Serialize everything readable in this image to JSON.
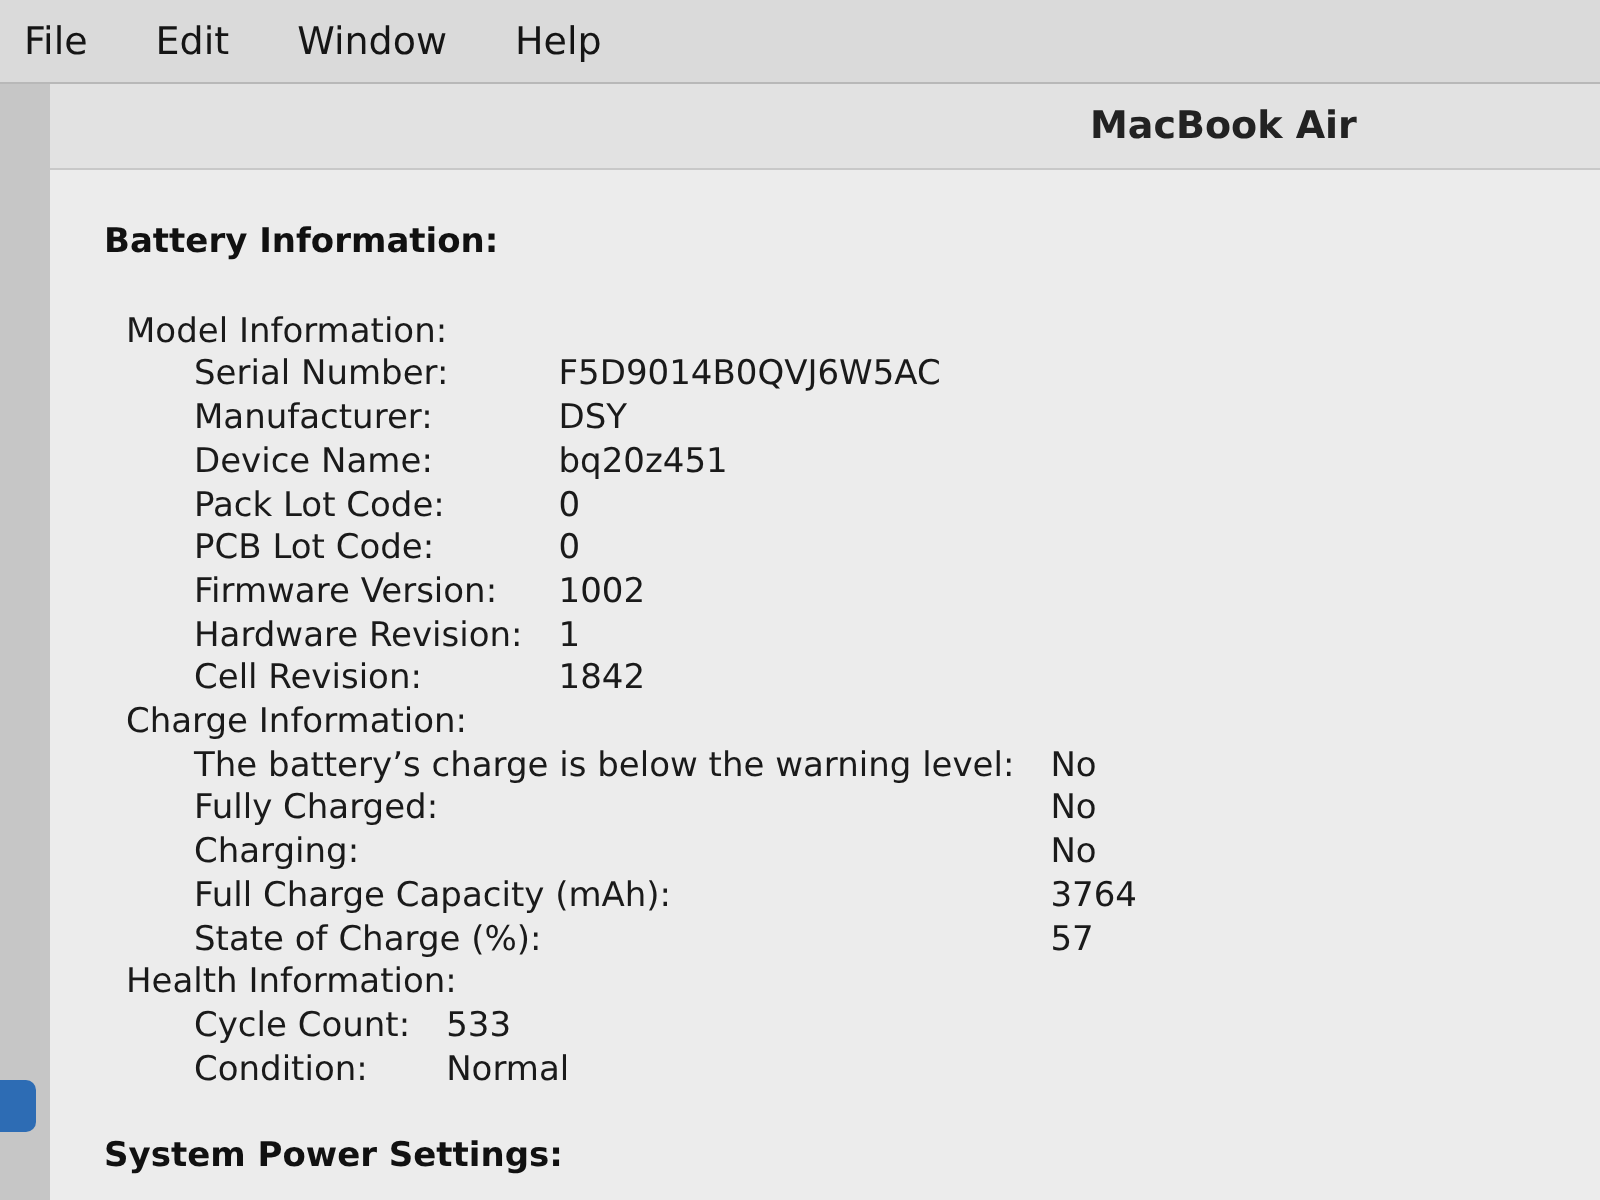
{
  "menu_bar": {
    "items": [
      "File",
      "Edit",
      "Window",
      "Help"
    ]
  },
  "sidebar": {
    "items": [
      {
        "selected": true
      }
    ]
  },
  "header": {
    "title": "MacBook Air"
  },
  "content": {
    "sections": [
      {
        "title": "Battery Information:",
        "groups": [
          {
            "title": "Model Information:",
            "rows": [
              {
                "label": "Serial Number:",
                "value": "F5D9014B0QVJ6W5AC"
              },
              {
                "label": "Manufacturer:",
                "value": "DSY"
              },
              {
                "label": "Device Name:",
                "value": "bq20z451"
              },
              {
                "label": "Pack Lot Code:",
                "value": "0"
              },
              {
                "label": "PCB Lot Code:",
                "value": "0"
              },
              {
                "label": "Firmware Version:",
                "value": "1002"
              },
              {
                "label": "Hardware Revision:",
                "value": "1"
              },
              {
                "label": "Cell Revision:",
                "value": "1842"
              }
            ]
          },
          {
            "title": "Charge Information:",
            "rows": [
              {
                "label": "The battery’s charge is below the warning level:",
                "value": "No"
              },
              {
                "label": "Fully Charged:",
                "value": "No"
              },
              {
                "label": "Charging:",
                "value": "No"
              },
              {
                "label": "Full Charge Capacity (mAh):",
                "value": "3764"
              },
              {
                "label": "State of Charge (%):",
                "value": "57"
              }
            ]
          },
          {
            "title": "Health Information:",
            "rows": [
              {
                "label": "Cycle Count:",
                "value": "533"
              },
              {
                "label": "Condition:",
                "value": "Normal"
              }
            ]
          }
        ]
      },
      {
        "title": "System Power Settings:"
      }
    ]
  }
}
